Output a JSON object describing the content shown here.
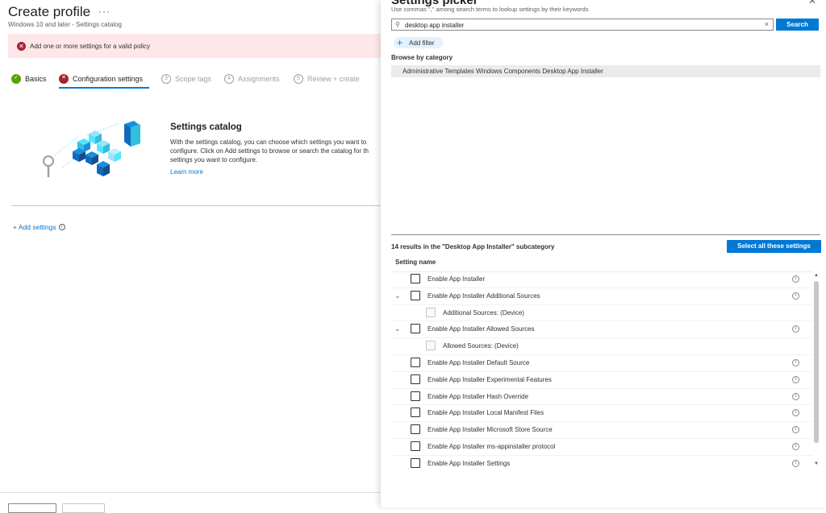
{
  "page": {
    "title": "Create profile",
    "subtitle": "Windows 10 and later - Settings catalog",
    "more_glyph": "···"
  },
  "error": {
    "message": "Add one or more settings for a valid policy",
    "color": "#a4262c"
  },
  "wizard": {
    "steps": [
      {
        "label": "Basics",
        "state": "done"
      },
      {
        "label": "Configuration settings",
        "state": "error",
        "active": true
      },
      {
        "label": "Scope tags",
        "number": "3",
        "state": "pending"
      },
      {
        "label": "Assignments",
        "number": "4",
        "state": "pending"
      },
      {
        "label": "Review + create",
        "number": "5",
        "state": "pending"
      }
    ]
  },
  "catalog": {
    "title": "Settings catalog",
    "description": "With the settings catalog, you can choose which settings you want to\nconfigure. Click on Add settings to browse or search the catalog for th\nsettings you want to configure.",
    "learn_more": "Learn more",
    "add_settings": "+ Add settings"
  },
  "picker": {
    "title": "Settings picker",
    "hint": "Use commas \",\" among search terms to lookup settings by their keywords",
    "search_value": "desktop app installer",
    "search_button": "Search",
    "add_filter": "Add filter",
    "browse_label": "Browse by category",
    "category": "Administrative Templates Windows Components Desktop App Installer",
    "results_label": "14 results in the \"Desktop App Installer\" subcategory",
    "select_all": "Select all these settings",
    "column_header": "Setting name",
    "accent": "#0078d4",
    "settings": [
      {
        "name": "Enable App Installer",
        "expandable": false,
        "child": false
      },
      {
        "name": "Enable App Installer Additional Sources",
        "expandable": true,
        "child": false
      },
      {
        "name": "Additional Sources: (Device)",
        "expandable": false,
        "child": true
      },
      {
        "name": "Enable App Installer Allowed Sources",
        "expandable": true,
        "child": false
      },
      {
        "name": "Allowed Sources: (Device)",
        "expandable": false,
        "child": true
      },
      {
        "name": "Enable App Installer Default Source",
        "expandable": false,
        "child": false
      },
      {
        "name": "Enable App Installer Experimental Features",
        "expandable": false,
        "child": false
      },
      {
        "name": "Enable App Installer Hash Override",
        "expandable": false,
        "child": false
      },
      {
        "name": "Enable App Installer Local Manifest Files",
        "expandable": false,
        "child": false
      },
      {
        "name": "Enable App Installer Microsoft Store Source",
        "expandable": false,
        "child": false
      },
      {
        "name": "Enable App Installer ms-appinstaller protocol",
        "expandable": false,
        "child": false
      },
      {
        "name": "Enable App Installer Settings",
        "expandable": false,
        "child": false
      }
    ]
  }
}
